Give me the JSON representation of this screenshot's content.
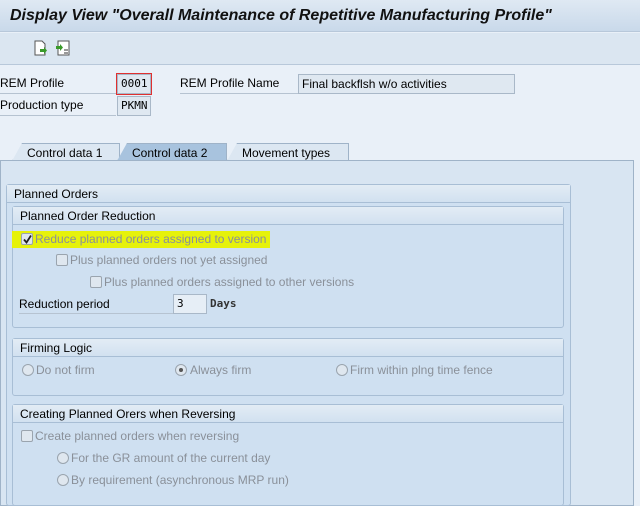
{
  "title": "Display View \"Overall Maintenance of Repetitive Manufacturing Profile\"",
  "toolbar": {
    "icons": [
      "new-entries-icon",
      "select-detail-icon"
    ]
  },
  "header": {
    "rem_profile_label": "REM Profile",
    "rem_profile_value": "0001",
    "rem_profile_name_label": "REM Profile Name",
    "rem_profile_name_value": "Final backflsh w/o activities",
    "production_type_label": "Production type",
    "production_type_value": "PKMN"
  },
  "tabs": [
    {
      "label": "Control data 1",
      "active": false
    },
    {
      "label": "Control data 2",
      "active": true
    },
    {
      "label": "Movement types",
      "active": false
    }
  ],
  "planned_orders": {
    "title": "Planned Orders",
    "reduction": {
      "title": "Planned Order Reduction",
      "reduce_label": "Reduce planned orders assigned to version",
      "reduce_checked": true,
      "highlight_color": "#e6f20a",
      "plus_not_assigned_label": "Plus planned orders not yet assigned",
      "plus_not_assigned_checked": false,
      "plus_other_label": "Plus planned orders assigned to other versions",
      "plus_other_checked": false,
      "period_label": "Reduction period",
      "period_value": "3",
      "period_unit": "Days"
    },
    "firming": {
      "title": "Firming Logic",
      "options": [
        {
          "label": "Do not firm",
          "selected": false
        },
        {
          "label": "Always firm",
          "selected": true
        },
        {
          "label": "Firm within plng time fence",
          "selected": false
        }
      ]
    },
    "reversing": {
      "title": "Creating Planned Orers when Reversing",
      "create_label": "Create planned orders when reversing",
      "create_checked": false,
      "options": [
        {
          "label": "For the GR amount of the current day",
          "selected": false
        },
        {
          "label": "By requirement (asynchronous MRP run)",
          "selected": false
        }
      ]
    }
  }
}
